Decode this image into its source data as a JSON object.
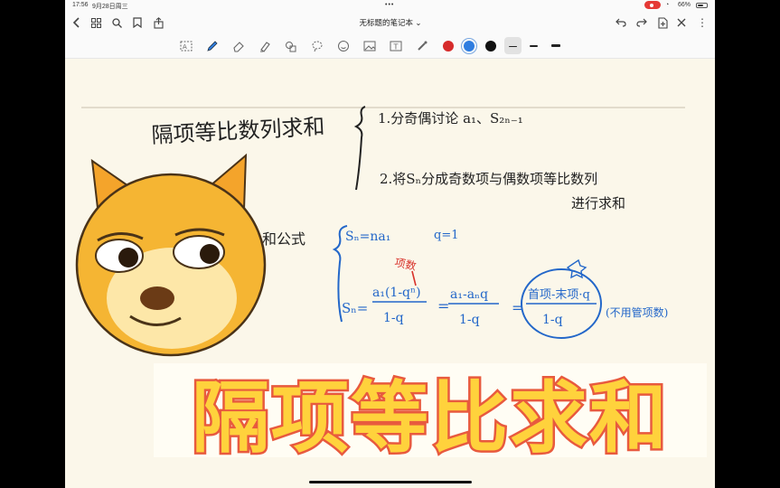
{
  "status": {
    "time": "17:56",
    "date": "9月28日周三",
    "battery": "66%"
  },
  "header": {
    "title": "无标题的笔记本"
  },
  "colors": {
    "page": "#fbf7ea",
    "ink_black": "#222222",
    "ink_blue": "#2367c9",
    "ink_red": "#d8332b",
    "banner_fill": "#ffd23c",
    "banner_outline": "#e85a3e"
  },
  "toolbar": {
    "tools": [
      "lasso-ocr-icon",
      "pen-icon",
      "eraser-icon",
      "highlighter-icon",
      "shapes-icon",
      "lasso-icon",
      "sticker-icon",
      "image-icon",
      "text-icon",
      "laser-pointer-icon"
    ],
    "colors": [
      "#d62b2b",
      "#2f7de0",
      "#111111"
    ],
    "selected_color": "#2f7de0",
    "strokes": [
      "thin",
      "medium",
      "thick"
    ]
  },
  "note": {
    "title": "隔项等比数列求和",
    "method_1": "1.分奇偶讨论 a₁、S₂ₙ₋₁",
    "method_2_line1": "2.将Sₙ分成奇数项与偶数项等比数列",
    "method_2_line2": "进行求和",
    "formula_label": "和公式",
    "case_1": "Sₙ=na₁",
    "case_1_cond": "q=1",
    "case_2_lhs": "Sₙ=",
    "case_2_num": "a₁(1-qⁿ)",
    "case_2_den": "1-q",
    "case_3_num": "a₁-aₙq",
    "case_3_den": "1-q",
    "circled_num": "首项-末项·q",
    "circled_den": "1-q",
    "red_note": "项数",
    "side_note": "(不用管项数)"
  },
  "banner": {
    "text": "隔项等比求和"
  }
}
